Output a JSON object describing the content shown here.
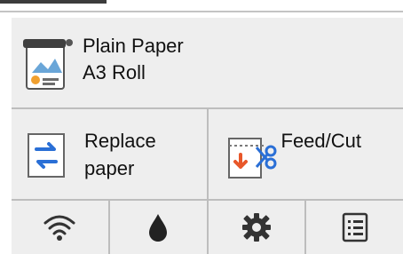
{
  "media": {
    "paper_type": "Plain Paper",
    "paper_source": "A3 Roll",
    "icon": "roll-paper-icon"
  },
  "actions": {
    "replace": {
      "line1": "Replace",
      "line2": "paper",
      "icon": "replace-paper-icon"
    },
    "feed": {
      "line1": "Feed/Cut",
      "icon": "feed-cut-icon"
    }
  },
  "bottom_bar": [
    {
      "name": "wifi-icon"
    },
    {
      "name": "ink-drop-icon"
    },
    {
      "name": "gear-icon"
    },
    {
      "name": "list-icon"
    }
  ],
  "colors": {
    "panel_bg": "#eeeeee",
    "divider": "#bdbdbd",
    "blue": "#2a6fd6",
    "orange": "#e8572a"
  }
}
